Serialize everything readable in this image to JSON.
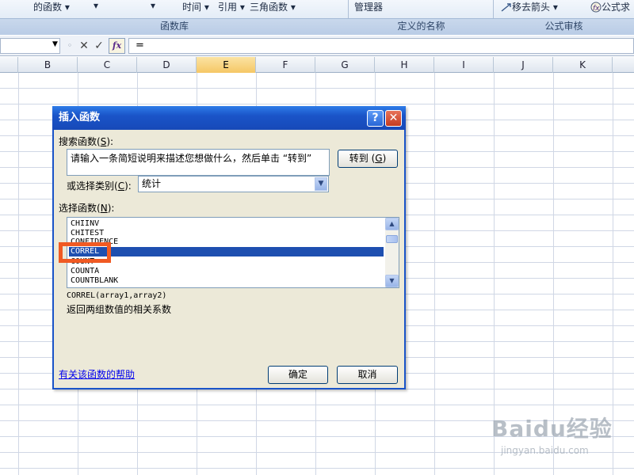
{
  "ribbon": {
    "items": [
      {
        "label": "的函数 ▾"
      },
      {
        "label": "▾"
      },
      {
        "label": "▾"
      },
      {
        "label": "时间 ▾"
      },
      {
        "label": "引用 ▾"
      },
      {
        "label": "三角函数 ▾"
      },
      {
        "label": "管理器"
      },
      {
        "label": "移去箭头 ▾"
      },
      {
        "label": "公式求"
      }
    ],
    "groups": [
      "函数库",
      "定义的名称",
      "公式审核"
    ]
  },
  "formula_bar": {
    "cancel_symbol": "✕",
    "enter_symbol": "✓",
    "fx_label": "fx",
    "formula": "="
  },
  "columns": [
    "B",
    "C",
    "D",
    "E",
    "F",
    "G",
    "H",
    "I",
    "J",
    "K"
  ],
  "selected_column": "E",
  "dialog": {
    "title": "插入函数",
    "help_glyph": "?",
    "close_glyph": "✕",
    "search_label": "搜索函数",
    "search_key": "S",
    "search_value": "请输入一条简短说明来描述您想做什么，然后单击 “转到”",
    "go_button": "转到",
    "go_key": "G",
    "category_label": "或选择类别",
    "category_key": "C",
    "category_value": "统计",
    "select_label": "选择函数",
    "select_key": "N",
    "functions": [
      "CHIINV",
      "CHITEST",
      "CONFIDENCE",
      "CORREL",
      "COUNT",
      "COUNTA",
      "COUNTBLANK"
    ],
    "selected_function": "CORREL",
    "signature": "CORREL(array1,array2)",
    "description": "返回两组数值的相关系数",
    "help_link": "有关该函数的帮助",
    "ok_button": "确定",
    "cancel_button": "取消"
  },
  "watermark": {
    "brand": "Baidu经验",
    "url": "jingyan.baidu.com"
  }
}
